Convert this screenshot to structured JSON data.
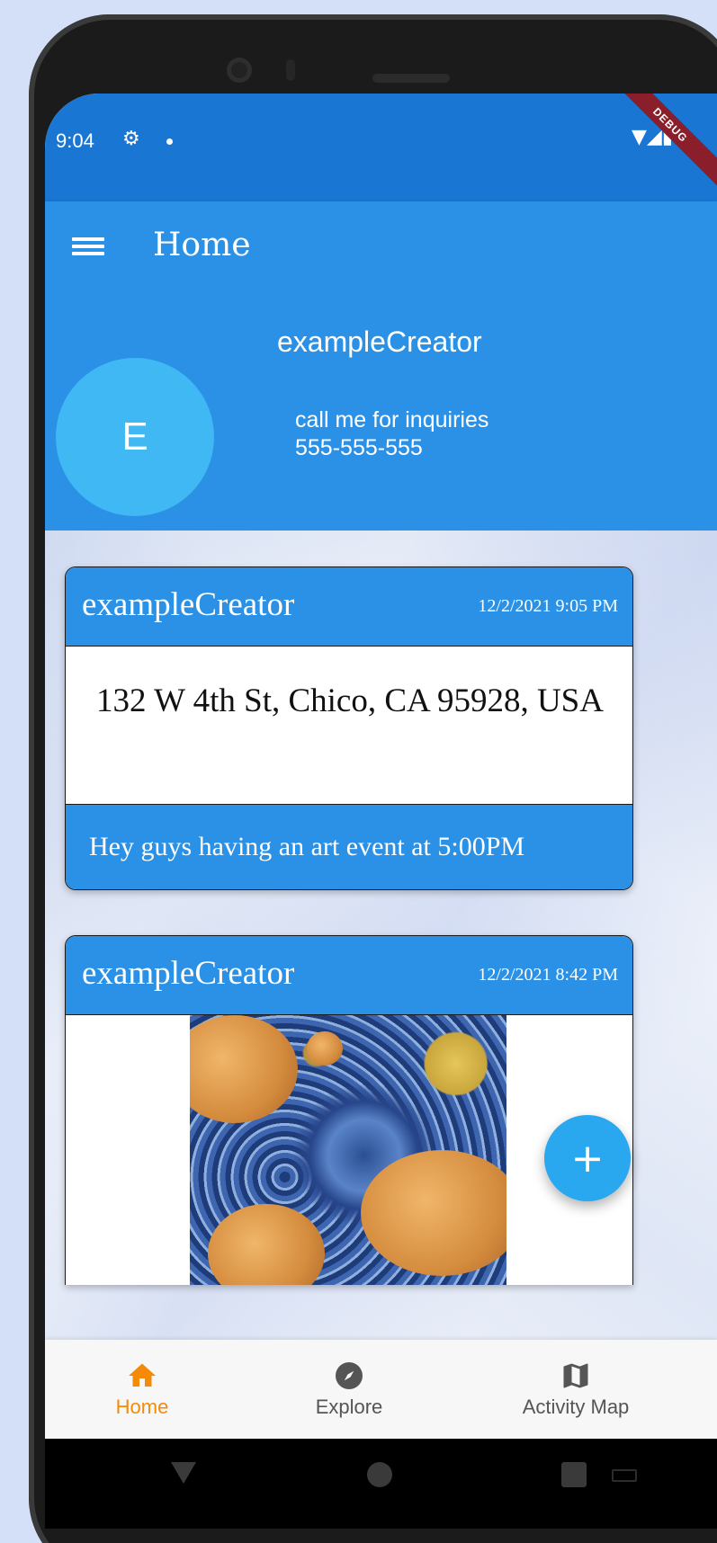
{
  "status_bar": {
    "time": "9:04",
    "debug_label": "DEBUG"
  },
  "app_bar": {
    "title": "Home"
  },
  "profile": {
    "avatar_letter": "E",
    "username": "exampleCreator",
    "bio": "call me for inquiries\n555-555-555"
  },
  "posts": [
    {
      "author": "exampleCreator",
      "date": "12/2/2021 9:05 PM",
      "address": "132 W 4th St, Chico, CA 95928, USA",
      "message": "Hey guys having an art event at 5:00PM"
    },
    {
      "author": "exampleCreator",
      "date": "12/2/2021 8:42 PM"
    }
  ],
  "fab": {
    "icon": "plus-icon",
    "label": "+"
  },
  "bottom_nav": {
    "items": [
      {
        "label": "Home",
        "icon": "home-icon",
        "active": true
      },
      {
        "label": "Explore",
        "icon": "compass-icon",
        "active": false
      },
      {
        "label": "Activity Map",
        "icon": "map-icon",
        "active": false
      }
    ]
  },
  "colors": {
    "primary": "#2a91e6",
    "status_bar": "#1976d2",
    "avatar": "#40b8f4",
    "fab": "#29a8ef",
    "active_nav": "#f58a07"
  }
}
